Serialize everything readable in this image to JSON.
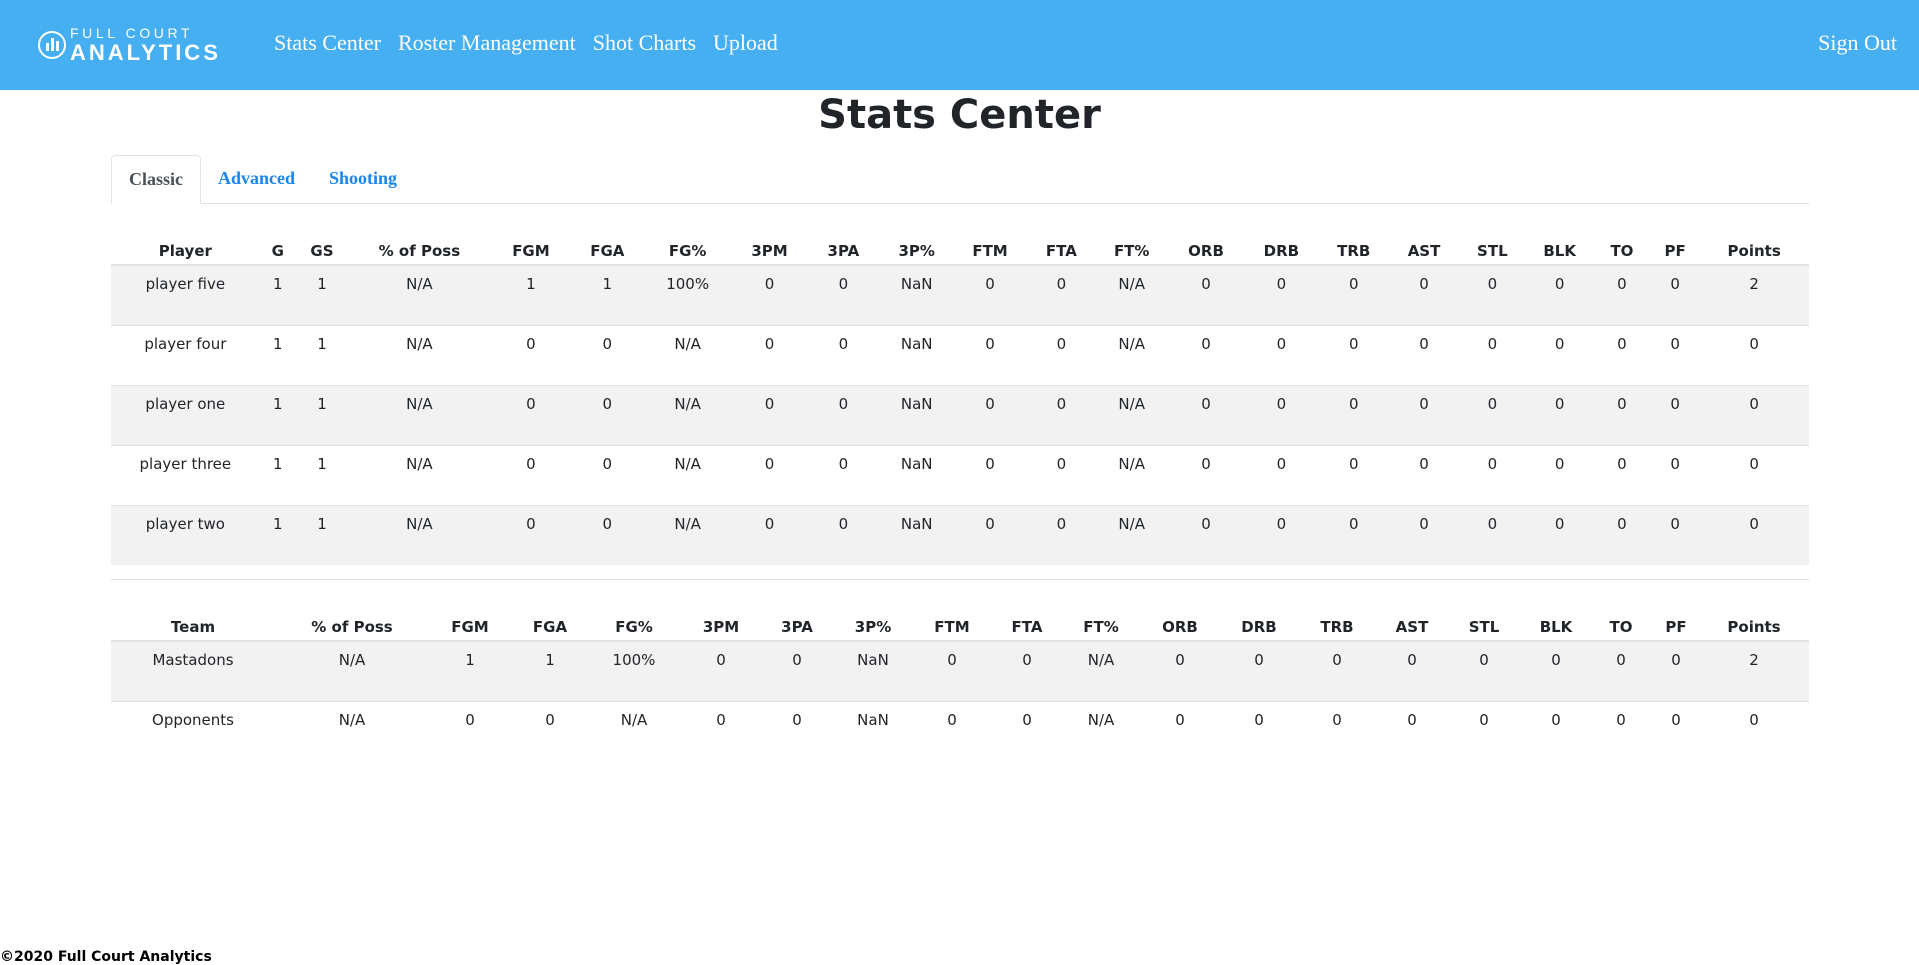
{
  "brand": {
    "line1": "FULL COURT",
    "line2": "ANALYTICS"
  },
  "nav": {
    "links": [
      "Stats Center",
      "Roster Management",
      "Shot Charts",
      "Upload"
    ],
    "sign_out": "Sign Out"
  },
  "page_title": "Stats Center",
  "tabs": [
    {
      "label": "Classic",
      "active": true
    },
    {
      "label": "Advanced",
      "active": false
    },
    {
      "label": "Shooting",
      "active": false
    }
  ],
  "player_table": {
    "headers": [
      "Player",
      "G",
      "GS",
      "% of Poss",
      "FGM",
      "FGA",
      "FG%",
      "3PM",
      "3PA",
      "3P%",
      "FTM",
      "FTA",
      "FT%",
      "ORB",
      "DRB",
      "TRB",
      "AST",
      "STL",
      "BLK",
      "TO",
      "PF",
      "Points"
    ],
    "rows": [
      [
        "player five",
        "1",
        "1",
        "N/A",
        "1",
        "1",
        "100%",
        "0",
        "0",
        "NaN",
        "0",
        "0",
        "N/A",
        "0",
        "0",
        "0",
        "0",
        "0",
        "0",
        "0",
        "0",
        "2"
      ],
      [
        "player four",
        "1",
        "1",
        "N/A",
        "0",
        "0",
        "N/A",
        "0",
        "0",
        "NaN",
        "0",
        "0",
        "N/A",
        "0",
        "0",
        "0",
        "0",
        "0",
        "0",
        "0",
        "0",
        "0"
      ],
      [
        "player one",
        "1",
        "1",
        "N/A",
        "0",
        "0",
        "N/A",
        "0",
        "0",
        "NaN",
        "0",
        "0",
        "N/A",
        "0",
        "0",
        "0",
        "0",
        "0",
        "0",
        "0",
        "0",
        "0"
      ],
      [
        "player three",
        "1",
        "1",
        "N/A",
        "0",
        "0",
        "N/A",
        "0",
        "0",
        "NaN",
        "0",
        "0",
        "N/A",
        "0",
        "0",
        "0",
        "0",
        "0",
        "0",
        "0",
        "0",
        "0"
      ],
      [
        "player two",
        "1",
        "1",
        "N/A",
        "0",
        "0",
        "N/A",
        "0",
        "0",
        "NaN",
        "0",
        "0",
        "N/A",
        "0",
        "0",
        "0",
        "0",
        "0",
        "0",
        "0",
        "0",
        "0"
      ]
    ]
  },
  "team_table": {
    "headers": [
      "Team",
      "% of Poss",
      "FGM",
      "FGA",
      "FG%",
      "3PM",
      "3PA",
      "3P%",
      "FTM",
      "FTA",
      "FT%",
      "ORB",
      "DRB",
      "TRB",
      "AST",
      "STL",
      "BLK",
      "TO",
      "PF",
      "Points"
    ],
    "rows": [
      [
        "Mastadons",
        "N/A",
        "1",
        "1",
        "100%",
        "0",
        "0",
        "NaN",
        "0",
        "0",
        "N/A",
        "0",
        "0",
        "0",
        "0",
        "0",
        "0",
        "0",
        "0",
        "2"
      ],
      [
        "Opponents",
        "N/A",
        "0",
        "0",
        "N/A",
        "0",
        "0",
        "NaN",
        "0",
        "0",
        "N/A",
        "0",
        "0",
        "0",
        "0",
        "0",
        "0",
        "0",
        "0",
        "0"
      ]
    ]
  },
  "footer": "©2020 Full Court Analytics",
  "colors": {
    "navbar": "#45aff1",
    "tab_link": "#1a86f0",
    "stripe": "#f2f2f2"
  }
}
